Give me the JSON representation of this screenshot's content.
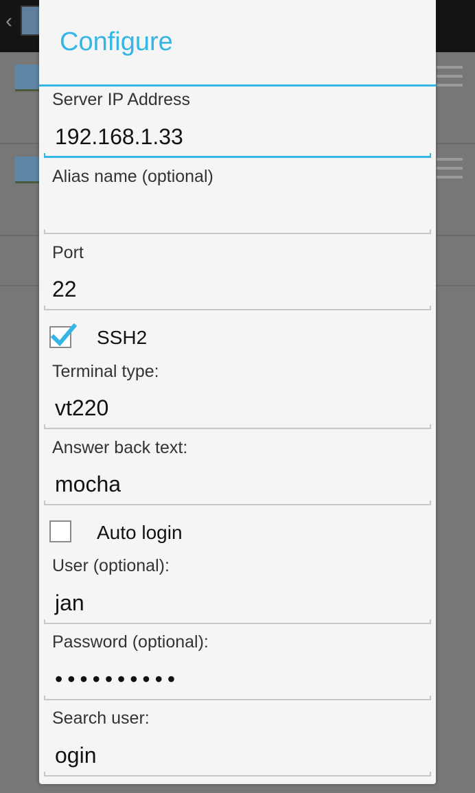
{
  "dialog": {
    "title": "Configure",
    "accent_color": "#33b5e5"
  },
  "fields": {
    "server_ip": {
      "label": "Server IP Address",
      "value": "192.168.1.33"
    },
    "alias": {
      "label": "Alias name (optional)",
      "value": ""
    },
    "port": {
      "label": "Port",
      "value": "22"
    },
    "terminal_type": {
      "label": "Terminal type:",
      "value": "vt220"
    },
    "answer_back": {
      "label": "Answer back text:",
      "value": "mocha"
    },
    "user": {
      "label": "User (optional):",
      "value": "jan"
    },
    "password": {
      "label": "Password (optional):",
      "value": "••••••••••"
    },
    "search_user": {
      "label": "Search user:",
      "value": "ogin"
    }
  },
  "checkboxes": {
    "ssh2": {
      "label": "SSH2",
      "checked": true
    },
    "auto_login": {
      "label": "Auto login",
      "checked": false
    }
  }
}
